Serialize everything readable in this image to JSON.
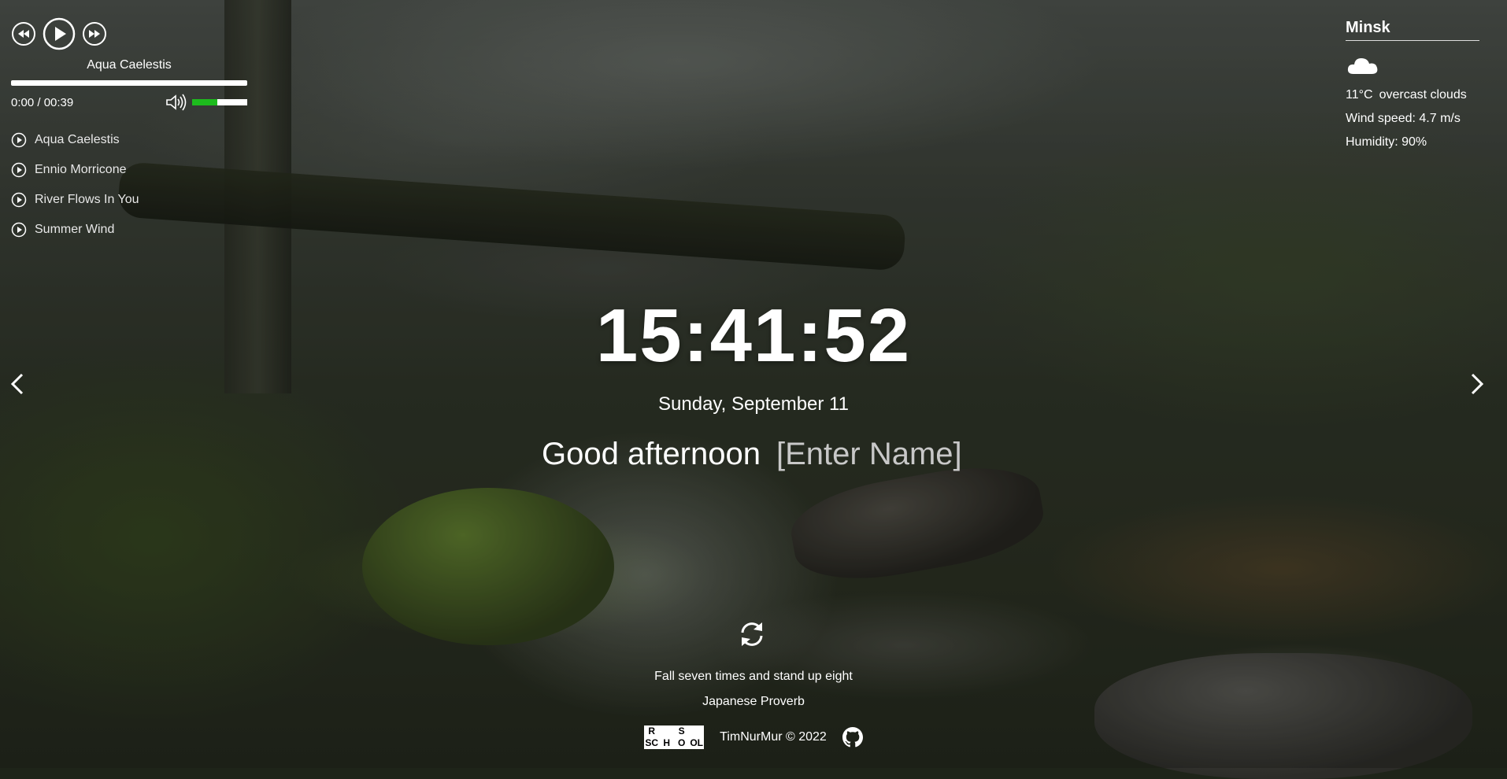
{
  "player": {
    "current_track": "Aqua Caelestis",
    "time": "0:00 / 00:39",
    "progress": 0,
    "volume": 0.45,
    "playlist": [
      {
        "label": "Aqua Caelestis"
      },
      {
        "label": "Ennio Morricone"
      },
      {
        "label": "River Flows In You"
      },
      {
        "label": "Summer Wind"
      }
    ]
  },
  "weather": {
    "city": "Minsk",
    "icon": "cloud-icon",
    "temperature": "11°C",
    "description": "overcast clouds",
    "wind": "Wind speed: 4.7 m/s",
    "humidity": "Humidity: 90%"
  },
  "clock": {
    "time": "15:41:52",
    "date": "Sunday, September 11"
  },
  "greeting": {
    "text": "Good afternoon",
    "name_placeholder": "[Enter Name]"
  },
  "quote": {
    "text": "Fall seven times and stand up eight",
    "author": "Japanese Proverb"
  },
  "footer": {
    "logo_letters": [
      "R",
      "",
      "S",
      "",
      "SC",
      "H",
      "O",
      "OL"
    ],
    "copyright": "TimNurMur © 2022"
  },
  "colors": {
    "volume_fill": "#1dbb1d",
    "text": "#ffffff"
  }
}
